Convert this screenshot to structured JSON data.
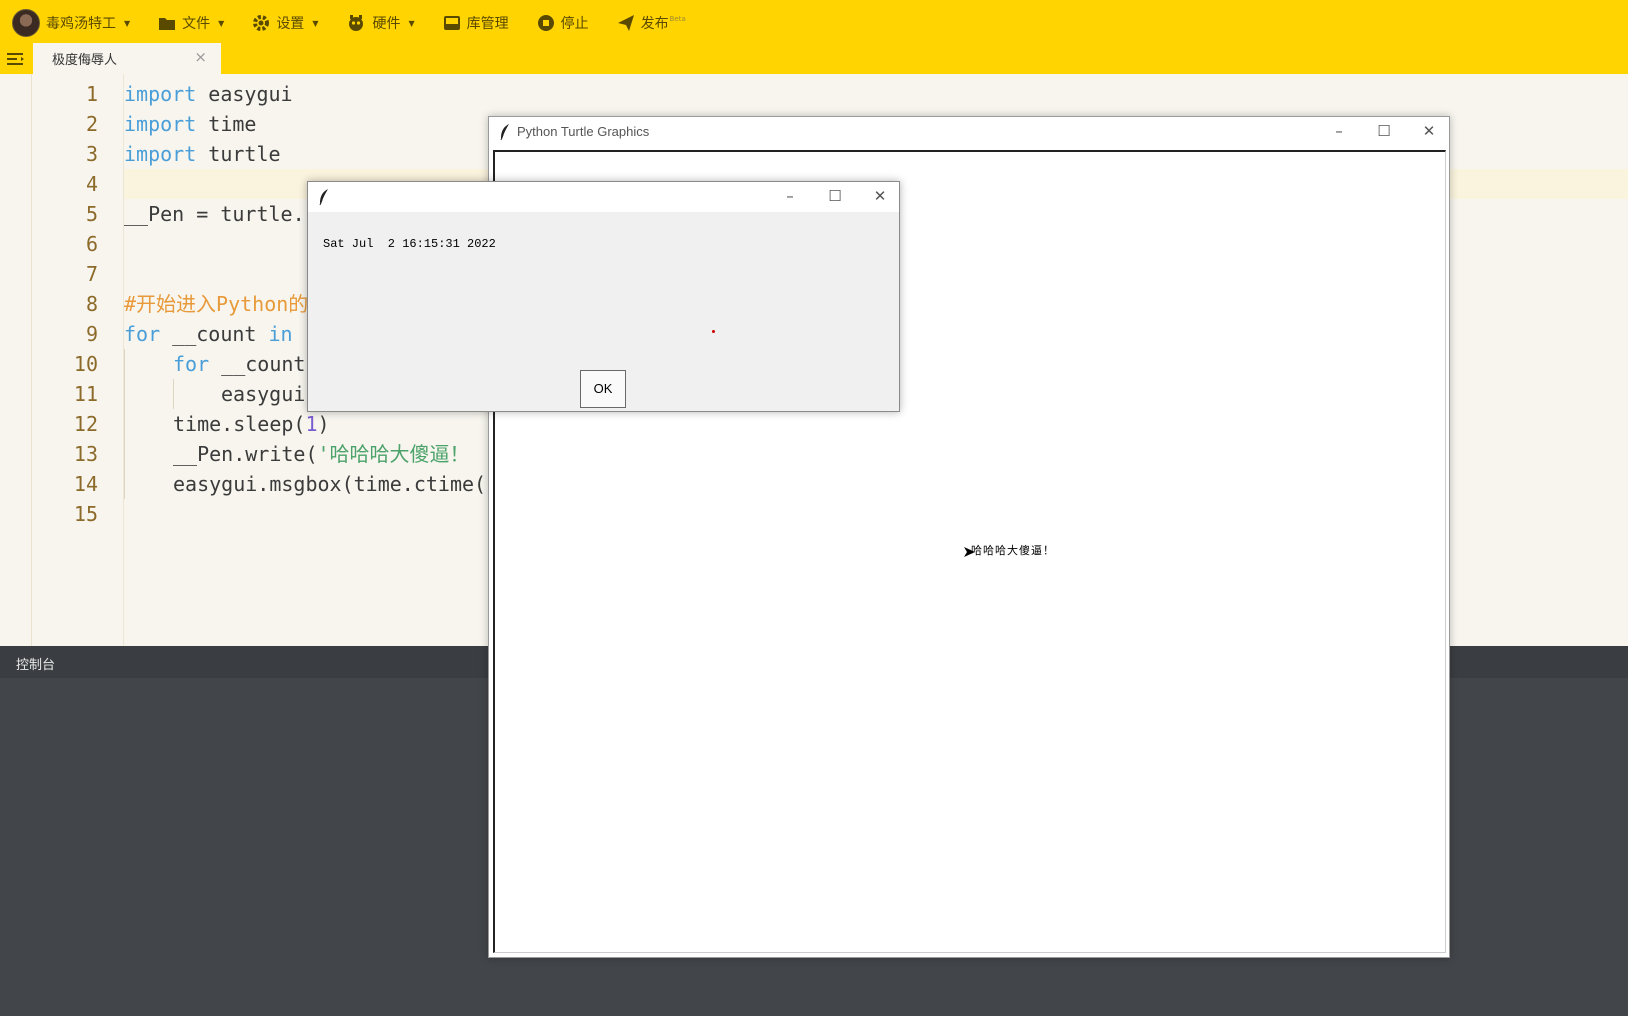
{
  "toolbar": {
    "user_name": "毒鸡汤特工",
    "menu": [
      {
        "label": "文件",
        "icon": "folder-icon"
      },
      {
        "label": "设置",
        "icon": "gear-icon"
      },
      {
        "label": "硬件",
        "icon": "robot-icon"
      },
      {
        "label": "库管理",
        "icon": "inbox-icon"
      },
      {
        "label": "停止",
        "icon": "stop-icon"
      },
      {
        "label": "发布",
        "icon": "send-icon",
        "badge": "Beta"
      }
    ]
  },
  "tabs": [
    {
      "label": "极度侮辱人",
      "close": "×"
    }
  ],
  "editor": {
    "line_numbers": [
      "1",
      "2",
      "3",
      "4",
      "5",
      "6",
      "7",
      "8",
      "9",
      "10",
      "11",
      "12",
      "13",
      "14",
      "15"
    ],
    "lines": {
      "l1_kw": "import",
      "l1_rest": " easygui",
      "l2_kw": "import",
      "l2_rest": " time",
      "l3_kw": "import",
      "l3_rest": " turtle",
      "l5": "__Pen = turtle.",
      "l8": "#开始进入Python的",
      "l9_kw": "for",
      "l9_mid": " __count ",
      "l9_kw2": "in",
      "l10_kw": "for",
      "l10_rest": " __count",
      "l11": "easygui",
      "l12_a": "time.sleep(",
      "l12_num": "1",
      "l12_b": ")",
      "l13_a": "__Pen.write(",
      "l13_str": "'哈哈哈大傻逼！",
      "l14": "easygui.msgbox(time.ctime("
    }
  },
  "console": {
    "title": "控制台"
  },
  "turtle_window": {
    "title": "Python Turtle Graphics",
    "canvas_text": "哈哈哈大傻逼！"
  },
  "msgbox": {
    "message": "Sat Jul  2 16:15:31 2022",
    "ok_label": "OK"
  },
  "colors": {
    "toolbar": "#ffd400",
    "editor_bg": "#f7f5ee",
    "keyword": "#4a9ed8",
    "comment": "#e89a3a",
    "string": "#4ba26a",
    "console_bg": "#424549"
  }
}
